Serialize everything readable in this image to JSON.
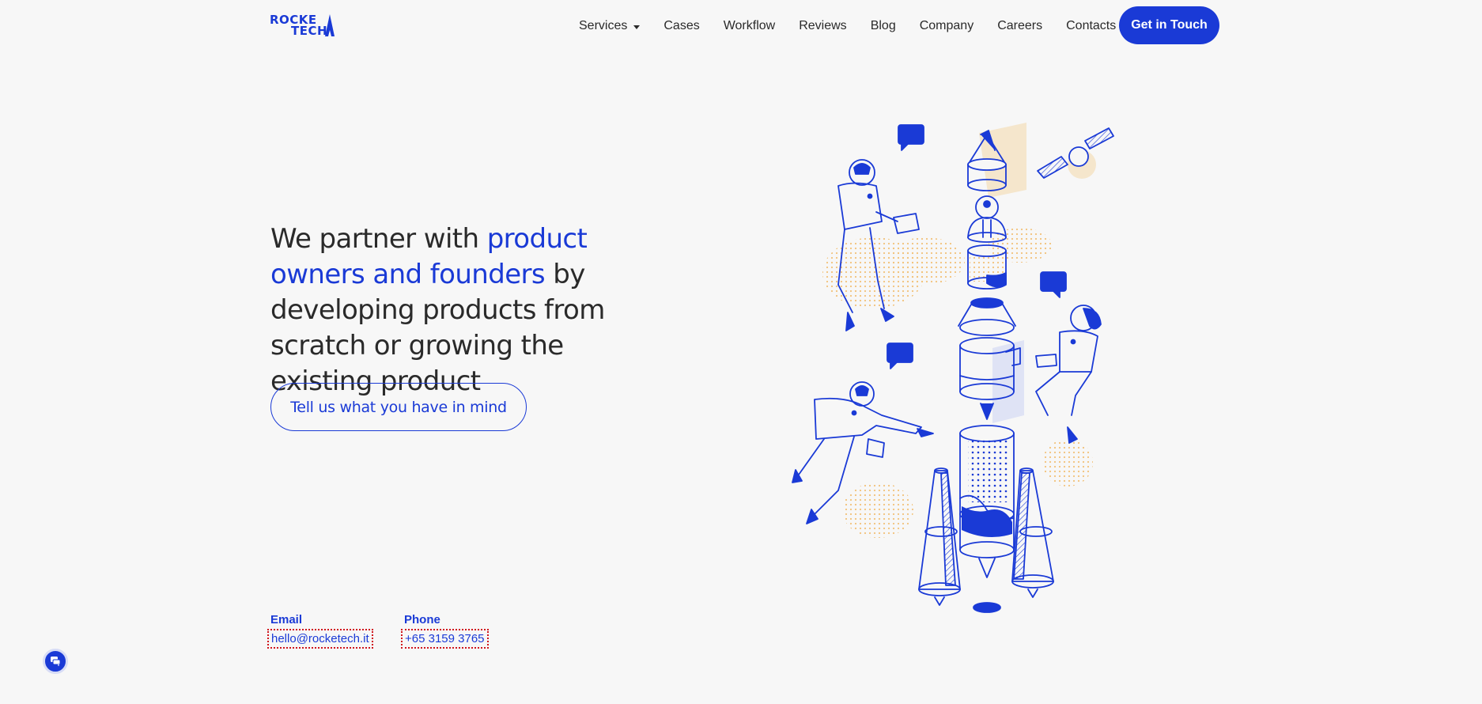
{
  "header": {
    "logo_top": "ROCKE",
    "logo_bottom": "TECH",
    "nav": [
      {
        "label": "Services",
        "has_caret": true
      },
      {
        "label": "Cases"
      },
      {
        "label": "Workflow"
      },
      {
        "label": "Reviews"
      },
      {
        "label": "Blog"
      },
      {
        "label": "Company"
      },
      {
        "label": "Careers"
      },
      {
        "label": "Contacts"
      }
    ],
    "cta_label": "Get in Touch"
  },
  "hero": {
    "title_part1": "We partner with ",
    "title_accent": "product owners and founders",
    "title_part2": " by developing products from scratch or growing the existing product",
    "button_label": "Tell us what you have in mind"
  },
  "contacts": {
    "email_label": "Email",
    "email_value": "hello@rocketech.it",
    "phone_label": "Phone",
    "phone_value": "+65 3159 3765"
  },
  "colors": {
    "accent": "#1a3ad6",
    "background": "#f7f7f7",
    "text": "#2a2a2a",
    "highlight_beige": "#f5e6cc",
    "dots_orange": "#f2c27a"
  },
  "icons": {
    "chat": "chat-icon",
    "illustration": "rocket-astronauts-illustration"
  }
}
